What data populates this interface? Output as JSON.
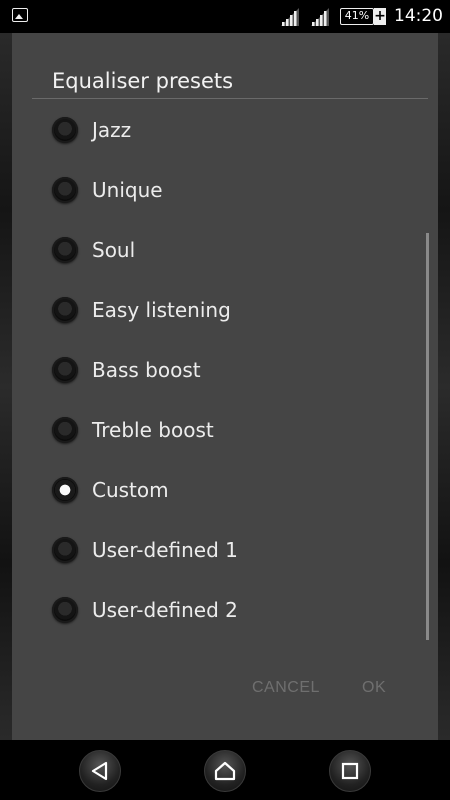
{
  "status_bar": {
    "battery_percent": "41%",
    "charging_symbol": "+",
    "time": "14:20",
    "icons": [
      "image-notification-icon",
      "signal-icon",
      "signal-icon",
      "battery-icon",
      "charging-icon"
    ]
  },
  "dialog": {
    "title": "Equaliser presets",
    "options": [
      {
        "label": "Jazz",
        "checked": false
      },
      {
        "label": "Unique",
        "checked": false
      },
      {
        "label": "Soul",
        "checked": false
      },
      {
        "label": "Easy listening",
        "checked": false
      },
      {
        "label": "Bass boost",
        "checked": false
      },
      {
        "label": "Treble boost",
        "checked": false
      },
      {
        "label": "Custom",
        "checked": true
      },
      {
        "label": "User-defined 1",
        "checked": false
      },
      {
        "label": "User-defined 2",
        "checked": false
      }
    ],
    "cancel_label": "CANCEL",
    "ok_label": "OK"
  },
  "nav_bar": {
    "icons": [
      "back-icon",
      "home-icon",
      "recents-icon"
    ]
  },
  "colors": {
    "dialog_bg": "#454545",
    "button_text_disabled": "#6f6f6f",
    "radio_selected": "#fafafa"
  }
}
